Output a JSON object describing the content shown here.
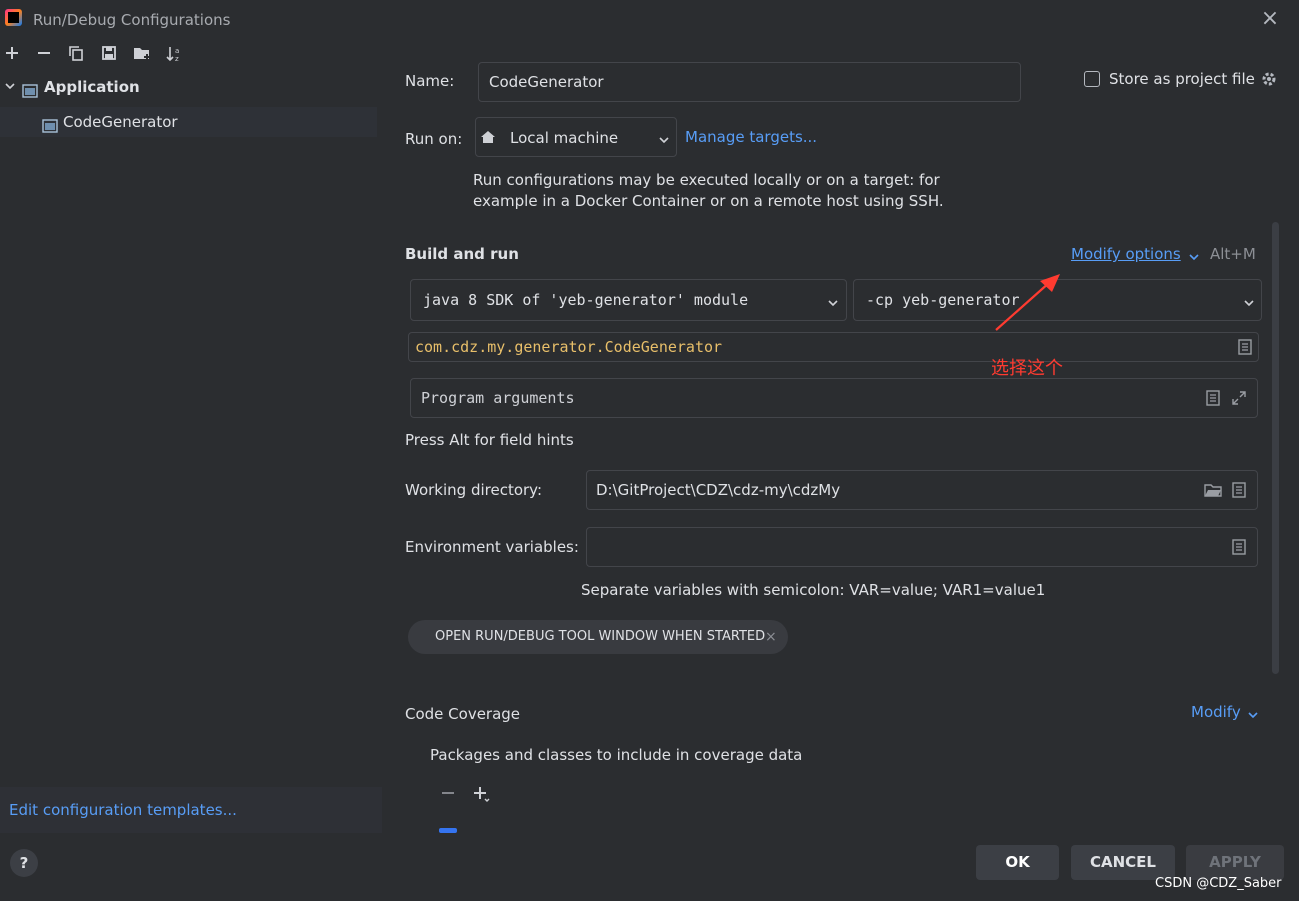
{
  "window": {
    "title": "Run/Debug Configurations",
    "close_glyph": "×"
  },
  "toolbar": {
    "add": "add-icon",
    "remove": "remove-icon",
    "copy": "copy-icon",
    "save": "save-icon",
    "new_folder": "new-folder-icon",
    "sort": "sort-icon"
  },
  "tree": {
    "group": "Application",
    "items": [
      "CodeGenerator"
    ]
  },
  "left_footer": {
    "edit_templates": "Edit configuration templates..."
  },
  "form": {
    "name_label": "Name:",
    "name_value": "CodeGenerator",
    "store_label": "Store as project file",
    "store_checked": false,
    "run_on_label": "Run on:",
    "run_on_value": "Local machine",
    "manage_targets": "Manage targets...",
    "run_on_hint_1": "Run configurations may be executed locally or on a target: for",
    "run_on_hint_2": "example in a Docker Container or on a remote host using SSH.",
    "build_run_header": "Build and run",
    "modify_options": "Modify options",
    "modify_shortcut": "Alt+M",
    "sdk_value": "java 8 SDK of 'yeb-generator' module",
    "cp_value": "-cp yeb-generator",
    "main_class": "com.cdz.my.generator.CodeGenerator",
    "program_args_placeholder": "Program arguments",
    "field_hints": "Press Alt for field hints",
    "workdir_label": "Working directory:",
    "workdir_value": "D:\\GitProject\\CDZ\\cdz-my\\cdzMy",
    "env_label": "Environment variables:",
    "env_value": "",
    "env_hint": "Separate variables with semicolon: VAR=value; VAR1=value1",
    "chip_label": "OPEN RUN/DEBUG TOOL WINDOW WHEN STARTED",
    "chip_close": "×",
    "coverage_header": "Code Coverage",
    "coverage_modify": "Modify",
    "coverage_desc": "Packages and classes to include in coverage data"
  },
  "annotation": {
    "text": "选择这个"
  },
  "buttons": {
    "ok": "OK",
    "cancel": "CANCEL",
    "apply": "APPLY",
    "help": "?"
  },
  "watermark": "CSDN @CDZ_Saber",
  "colors": {
    "background": "#2b2d30",
    "link": "#589df6",
    "annotation": "#ff3b30",
    "class_name": "#e8bf6a",
    "ok_button": "#3c3f45"
  }
}
